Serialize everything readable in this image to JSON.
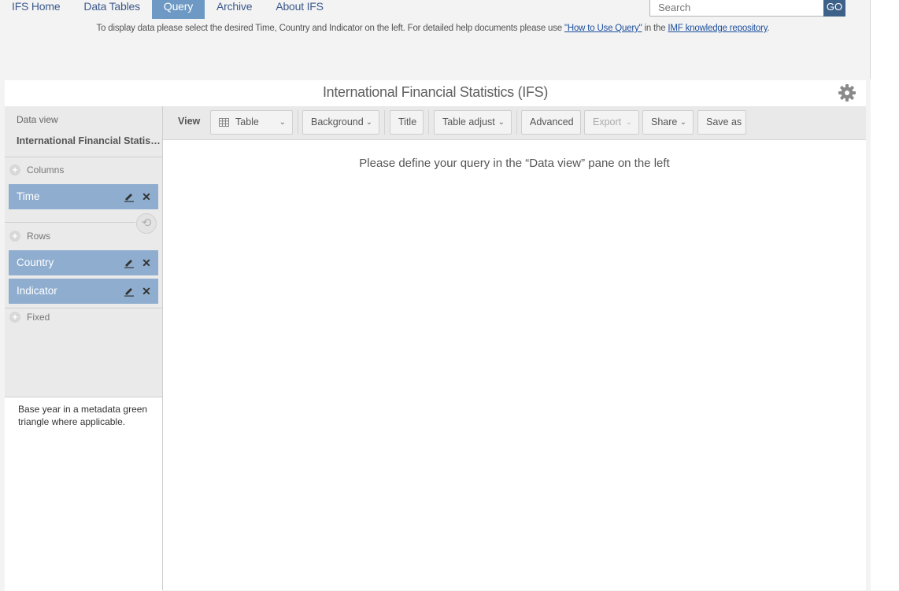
{
  "nav": {
    "tabs": [
      {
        "label": "IFS Home"
      },
      {
        "label": "Data Tables"
      },
      {
        "label": "Query"
      },
      {
        "label": "Archive"
      },
      {
        "label": "About IFS"
      }
    ],
    "active_tab": "Query"
  },
  "search": {
    "placeholder": "Search",
    "go_label": "GO"
  },
  "help": {
    "prefix": "To display data please select the desired Time, Country and Indicator on the left.  For detailed help documents please use ",
    "link1": "\"How to Use Query\"",
    "middle": " in the ",
    "link2": "IMF knowledge repository",
    "suffix": "."
  },
  "page": {
    "title": "International Financial Statistics (IFS)"
  },
  "left_pane": {
    "data_view_label": "Data view",
    "data_view_name": "International Financial Statistics (IFS)",
    "columns_label": "Columns",
    "rows_label": "Rows",
    "fixed_label": "Fixed",
    "columns": [
      {
        "label": "Time"
      }
    ],
    "rows": [
      {
        "label": "Country"
      },
      {
        "label": "Indicator"
      }
    ],
    "note": "Base year in a metadata green triangle where applicable."
  },
  "toolbar": {
    "view_label": "View",
    "table": "Table",
    "background": "Background",
    "title": "Title",
    "table_adjust": "Table adjust",
    "advanced": "Advanced",
    "export": "Export",
    "share": "Share",
    "save_as": "Save as"
  },
  "content": {
    "empty_message": "Please define your query in the “Data view” pane on the left"
  },
  "colors": {
    "accent": "#6d99c4",
    "chip": "#8fadcf",
    "go": "#3e6189",
    "link": "#1d4f9c"
  },
  "icons": [
    "gear-icon",
    "plus-icon",
    "pencil-icon",
    "close-icon",
    "swap-icon",
    "table-icon",
    "chevron-down-icon"
  ]
}
